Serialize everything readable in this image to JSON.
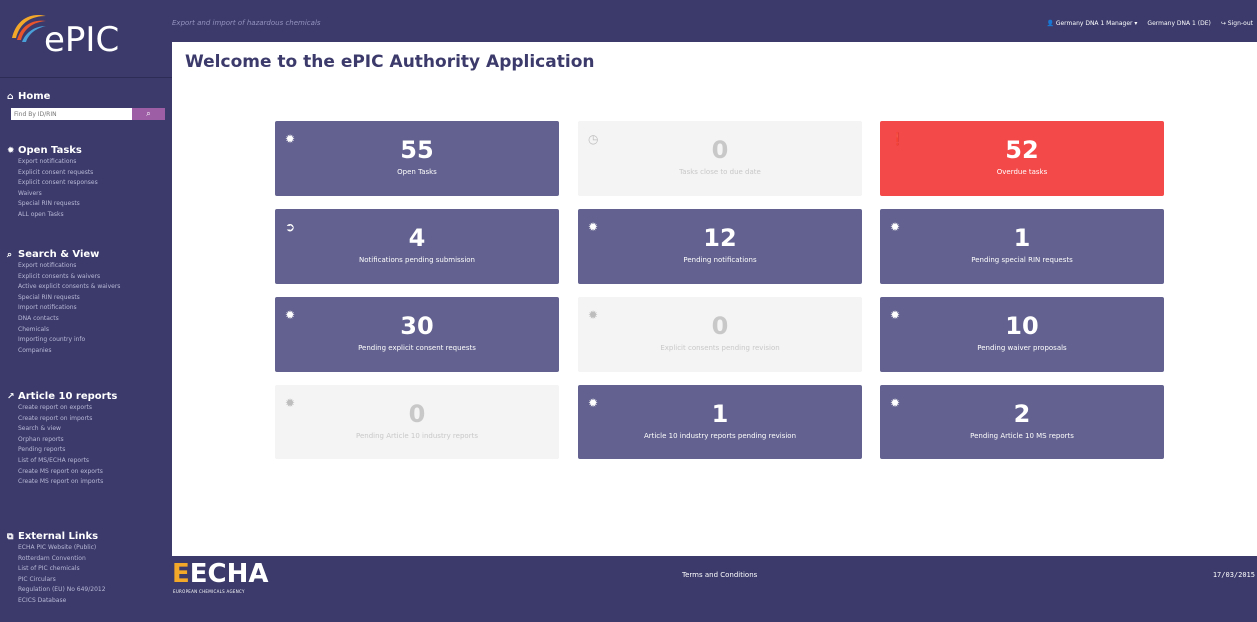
{
  "app": {
    "logo_text": "ePIC",
    "subtitle": "Export and import of hazardous chemicals",
    "page_title": "Welcome to the ePIC Authority Application"
  },
  "user_menu": {
    "user": "Germany DNA 1 Manager",
    "org": "Germany DNA 1 (DE)",
    "signout": "Sign-out"
  },
  "sidebar": {
    "home_label": "Home",
    "search_placeholder": "Find By ID/RIN",
    "sections": [
      {
        "title": "Open Tasks",
        "items": [
          "Export notifications",
          "Explicit consent requests",
          "Explicit consent responses",
          "Waivers",
          "Special RIN requests",
          "ALL open Tasks"
        ]
      },
      {
        "title": "Search & View",
        "items": [
          "Export notifications",
          "Explicit consents & waivers",
          "Active explicit consents & waivers",
          "Special RIN requests",
          "Import notifications",
          "DNA contacts",
          "Chemicals",
          "Importing country info",
          "Companies"
        ]
      },
      {
        "title": "Article 10 reports",
        "items": [
          "Create report on exports",
          "Create report on imports",
          "Search & view",
          "Orphan reports",
          "Pending reports",
          "List of MS/ECHA reports",
          "Create MS report on exports",
          "Create MS report on imports"
        ]
      },
      {
        "title": "External Links",
        "items": [
          "ECHA PIC Website (Public)",
          "Rotterdam Convention",
          "List of PIC chemicals",
          "PIC Circulars",
          "Regulation (EU) No 649/2012",
          "ECICS Database"
        ]
      }
    ]
  },
  "tiles": [
    {
      "value": "55",
      "label": "Open Tasks",
      "icon": "gear-icon"
    },
    {
      "value": "0",
      "label": "Tasks close to due date",
      "icon": "clock-icon"
    },
    {
      "value": "52",
      "label": "Overdue tasks",
      "icon": "alert-icon"
    },
    {
      "value": "4",
      "label": "Notifications pending submission",
      "icon": "arrow-circle-icon"
    },
    {
      "value": "12",
      "label": "Pending notifications",
      "icon": "gear-icon"
    },
    {
      "value": "1",
      "label": "Pending special RIN requests",
      "icon": "gear-icon"
    },
    {
      "value": "30",
      "label": "Pending explicit consent requests",
      "icon": "gear-icon"
    },
    {
      "value": "0",
      "label": "Explicit consents pending revision",
      "icon": "gear-icon"
    },
    {
      "value": "10",
      "label": "Pending waiver proposals",
      "icon": "gear-icon"
    },
    {
      "value": "0",
      "label": "Pending Article 10 industry reports",
      "icon": "gear-icon"
    },
    {
      "value": "1",
      "label": "Article 10 industry reports pending revision",
      "icon": "gear-icon"
    },
    {
      "value": "2",
      "label": "Pending Article 10 MS reports",
      "icon": "gear-icon"
    }
  ],
  "footer": {
    "logo_mark": "E",
    "logo_word": "ECHA",
    "logo_sub": "EUROPEAN CHEMICALS AGENCY",
    "terms": "Terms and Conditions",
    "date": "17/03/2015"
  },
  "colors": {
    "brand": "#3b3a6b",
    "tile": "#62618f",
    "tile_inactive": "#f4f4f4",
    "alert": "#f44949",
    "search_button": "#9d5ea6"
  }
}
